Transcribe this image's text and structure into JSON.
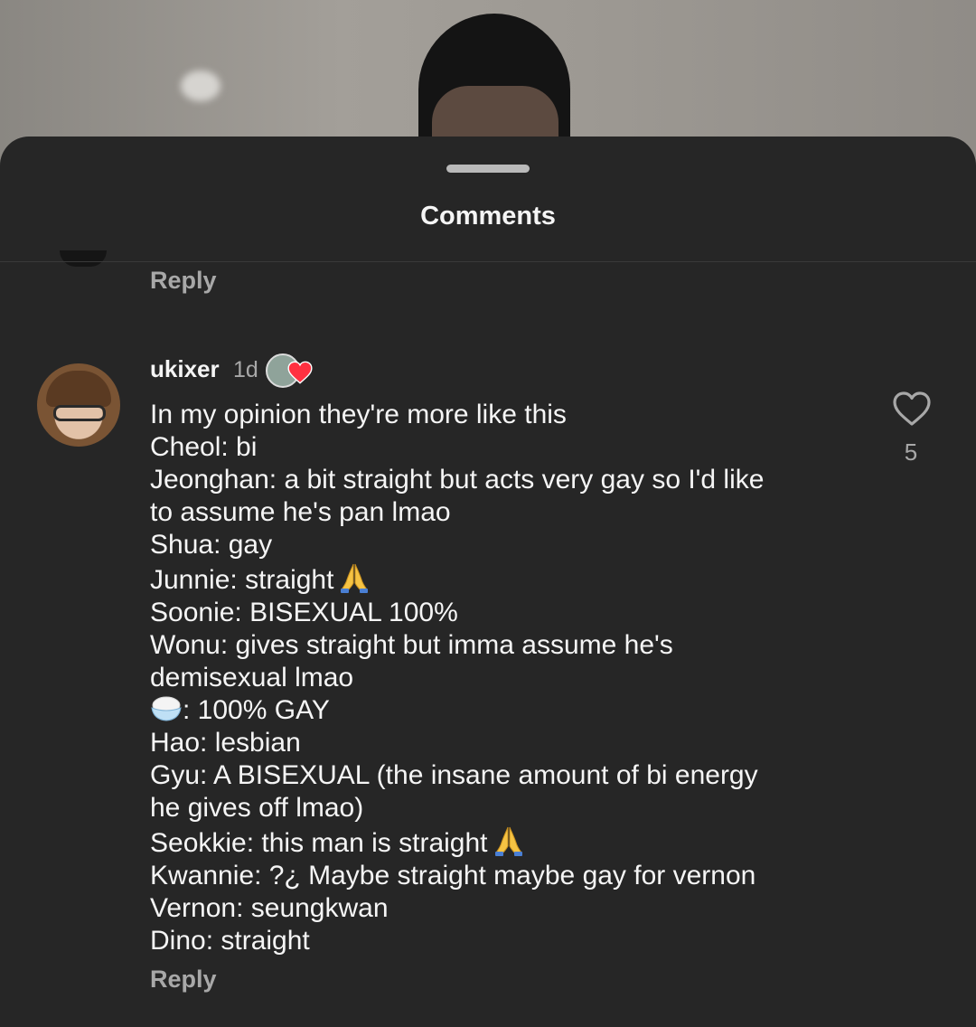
{
  "sheet": {
    "title": "Comments"
  },
  "previous_comment": {
    "reply_label": "Reply"
  },
  "comment": {
    "username": "ukixer",
    "timestamp": "1d",
    "lines": [
      "In my opinion they're more like this",
      "Cheol: bi",
      "Jeonghan: a bit straight but acts very gay so I'd like",
      "to assume he's pan lmao",
      "Shua: gay",
      "Junnie: straight",
      "Soonie: BISEXUAL 100%",
      "Wonu: gives straight but imma assume he's",
      "demisexual lmao",
      ": 100% GAY",
      "Hao: lesbian",
      "Gyu: A BISEXUAL (the insane amount of bi energy",
      "he gives off lmao)",
      "Seokkie: this man is straight",
      "Kwannie: ?¿ Maybe straight maybe gay for vernon",
      "Vernon: seungkwan",
      "Dino: straight"
    ],
    "like_count": "5",
    "reply_label": "Reply"
  },
  "icons": {
    "like": "heart-outline-icon",
    "emoji_rice": "rice-bowl-emoji",
    "emoji_pray": "folded-hands-emoji",
    "creator_liked": "creator-heart-badge"
  },
  "colors": {
    "sheet_bg": "#262626",
    "primary_text": "#f5f5f5",
    "secondary_text": "#a8a8a8",
    "heart_red": "#ff3040"
  }
}
